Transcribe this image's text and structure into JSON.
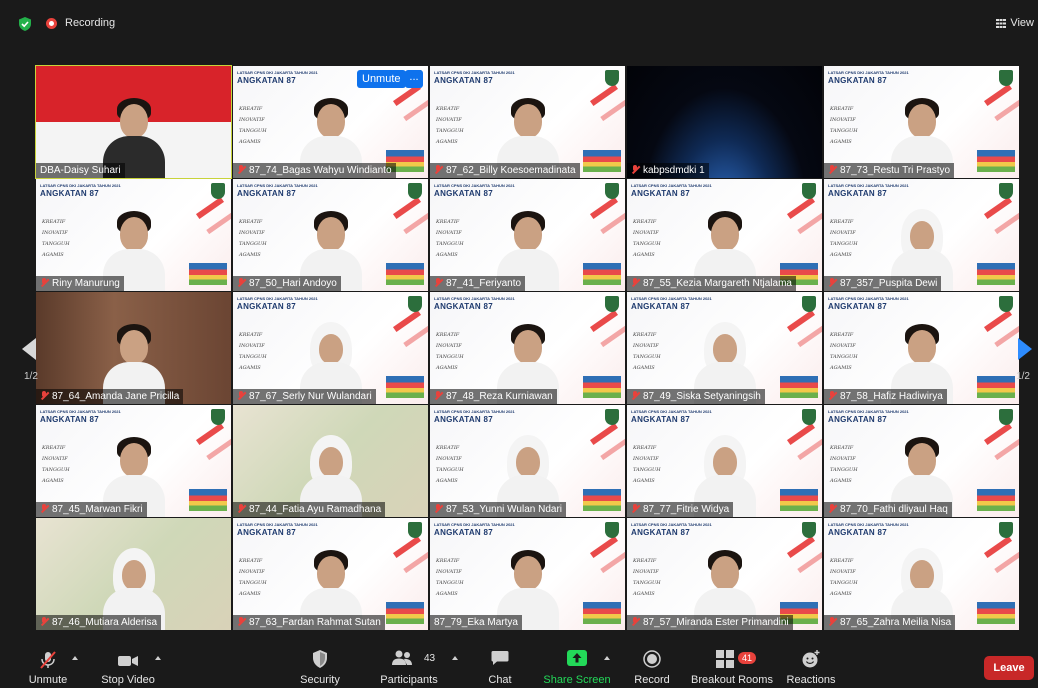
{
  "topbar": {
    "recording_label": "Recording",
    "view_label": "View"
  },
  "pagination": {
    "left": "1/2",
    "right": "1/2"
  },
  "video_controls": {
    "unmute_label": "Unmute",
    "more_label": "..."
  },
  "participants": [
    {
      "name": "DBA-Daisy Suhari",
      "muted": false,
      "bg": "flag",
      "active": true
    },
    {
      "name": "87_74_Bagas Wahyu Windianto",
      "muted": true,
      "bg": "slide"
    },
    {
      "name": "87_62_Billy Koesoemadinata",
      "muted": true,
      "bg": "slide"
    },
    {
      "name": "kabpsdmdki 1",
      "muted": true,
      "bg": "space"
    },
    {
      "name": "87_73_Restu Tri Prastyo",
      "muted": true,
      "bg": "slide"
    },
    {
      "name": "Riny Manurung",
      "muted": true,
      "bg": "slide"
    },
    {
      "name": "87_50_Hari Andoyo",
      "muted": true,
      "bg": "slide"
    },
    {
      "name": "87_41_Feriyanto",
      "muted": true,
      "bg": "slide"
    },
    {
      "name": "87_55_Kezia Margareth Ntjalama",
      "muted": true,
      "bg": "slide"
    },
    {
      "name": "87_357_Puspita Dewi",
      "muted": true,
      "bg": "slide",
      "hijab": true
    },
    {
      "name": "87_64_Amanda Jane Pricilla",
      "muted": true,
      "bg": "brown"
    },
    {
      "name": "87_67_Serly Nur Wulandari",
      "muted": true,
      "bg": "slide",
      "hijab": true
    },
    {
      "name": "87_48_Reza Kurniawan",
      "muted": true,
      "bg": "slide"
    },
    {
      "name": "87_49_Siska Setyaningsih",
      "muted": true,
      "bg": "slide",
      "hijab": true
    },
    {
      "name": "87_58_Hafiz Hadiwirya",
      "muted": true,
      "bg": "slide"
    },
    {
      "name": "87_45_Marwan Fikri",
      "muted": true,
      "bg": "slide"
    },
    {
      "name": "87_44_Fatia Ayu Ramadhana",
      "muted": true,
      "bg": "green",
      "hijab": true
    },
    {
      "name": "87_53_Yunni Wulan Ndari",
      "muted": true,
      "bg": "slide",
      "hijab": true
    },
    {
      "name": "87_77_Fitrie Widya",
      "muted": true,
      "bg": "slide",
      "hijab": true
    },
    {
      "name": "87_70_Fathi dliyaul Haq",
      "muted": true,
      "bg": "slide"
    },
    {
      "name": "87_46_Mutiara Alderisa",
      "muted": true,
      "bg": "green",
      "hijab": true
    },
    {
      "name": "87_63_Fardan Rahmat Sutan",
      "muted": true,
      "bg": "slide"
    },
    {
      "name": "87_79_Eka Martya",
      "muted": false,
      "bg": "slide"
    },
    {
      "name": "87_57_Miranda Ester Primandini",
      "muted": true,
      "bg": "slide"
    },
    {
      "name": "87_65_Zahra Meilia Nisa",
      "muted": true,
      "bg": "slide",
      "hijab": true
    }
  ],
  "slide_text": {
    "header_small": "LATSAR CPNS DKI JAKARTA TAHUN 2021",
    "header_big": "ANGKATAN 87",
    "words": [
      "KREATIF",
      "INOVATIF",
      "TANGGUH",
      "AGAMIS"
    ]
  },
  "toolbar": {
    "unmute": "Unmute",
    "stop_video": "Stop Video",
    "security": "Security",
    "participants": "Participants",
    "participants_count": "43",
    "chat": "Chat",
    "share_screen": "Share Screen",
    "record": "Record",
    "breakout_rooms": "Breakout Rooms",
    "breakout_count": "41",
    "reactions": "Reactions",
    "leave": "Leave"
  },
  "colors": {
    "accent": "#0e72ed",
    "share": "#23d959",
    "leave": "#c82828",
    "active_border": "#c8d33a"
  }
}
